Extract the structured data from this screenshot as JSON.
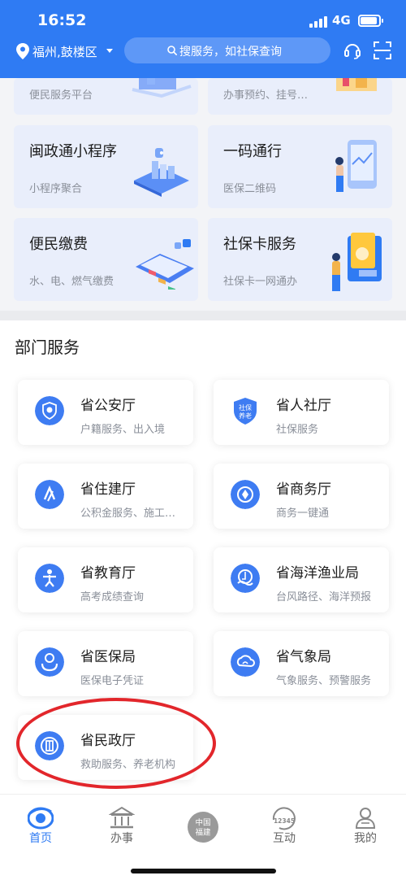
{
  "status_bar": {
    "time": "16:52",
    "network": "4G"
  },
  "header": {
    "location": "福州,鼓楼区",
    "search_placeholder": "搜服务，如社保查询",
    "accent_color": "#2f7bf3"
  },
  "service_cards": [
    {
      "sub": "便民服务平台"
    },
    {
      "sub": "办事预约、挂号…"
    },
    {
      "title": "闽政通小程序",
      "sub": "小程序聚合"
    },
    {
      "title": "一码通行",
      "sub": "医保二维码"
    },
    {
      "title": "便民缴费",
      "sub": "水、电、燃气缴费"
    },
    {
      "title": "社保卡服务",
      "sub": "社保卡一网通办"
    }
  ],
  "dept_section": {
    "heading": "部门服务",
    "items": [
      {
        "name": "省公安厅",
        "desc": "户籍服务、出入境",
        "icon": "police-badge-icon"
      },
      {
        "name": "省人社厅",
        "desc": "社保服务",
        "icon": "social-security-icon",
        "icon_text": "社保养老"
      },
      {
        "name": "省住建厅",
        "desc": "公积金服务、施工…",
        "icon": "housing-icon"
      },
      {
        "name": "省商务厅",
        "desc": "商务一键通",
        "icon": "commerce-icon"
      },
      {
        "name": "省教育厅",
        "desc": "高考成绩查询",
        "icon": "education-icon"
      },
      {
        "name": "省海洋渔业局",
        "desc": "台风路径、海洋预报",
        "icon": "ocean-fishery-icon"
      },
      {
        "name": "省医保局",
        "desc": "医保电子凭证",
        "icon": "medical-insurance-icon"
      },
      {
        "name": "省气象局",
        "desc": "气象服务、预警服务",
        "icon": "weather-icon"
      },
      {
        "name": "省民政厅",
        "desc": "救助服务、养老机构",
        "icon": "civil-affairs-icon"
      }
    ]
  },
  "annotation": {
    "color": "#e2262b",
    "shape": "ellipse",
    "target": "省民政厅"
  },
  "bottom_nav": [
    {
      "label": "首页",
      "icon": "home-icon",
      "active": true
    },
    {
      "label": "办事",
      "icon": "building-icon",
      "active": false
    },
    {
      "label": "",
      "icon": "fujian-emblem-icon",
      "emblem_text": "中国福建",
      "active": false
    },
    {
      "label": "互动",
      "icon": "hotline-icon",
      "emblem_text": "12345",
      "active": false
    },
    {
      "label": "我的",
      "icon": "profile-icon",
      "active": false
    }
  ]
}
